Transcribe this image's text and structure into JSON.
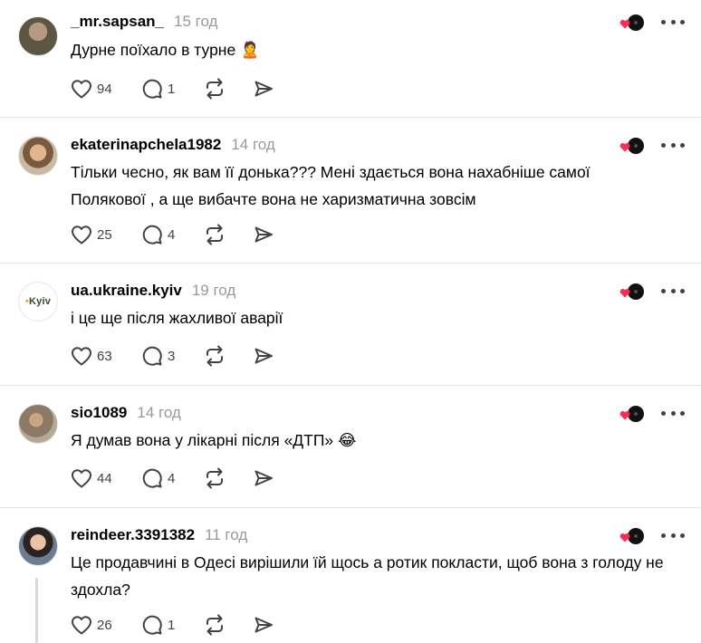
{
  "posts": [
    {
      "username": "_mr.sapsan_",
      "time": "15 год",
      "text": "Дурне поїхало в турне",
      "emoji": "🙎",
      "likes": "94",
      "replies": "1",
      "avatar": "person-avatar"
    },
    {
      "username": "ekaterinapchela1982",
      "time": "14 год",
      "text": "Тільки чесно, як вам її донька??? Мені здається вона нахабніше самої Полякової , а ще вибачте вона не харизматична зовсім",
      "likes": "25",
      "replies": "4",
      "avatar": "person-avatar"
    },
    {
      "username": "ua.ukraine.kyiv",
      "time": "19 год",
      "text": "і це ще після жахливої аварії",
      "likes": "63",
      "replies": "3",
      "avatar_logo_text": "Kyiv"
    },
    {
      "username": "sio1089",
      "time": "14 год",
      "text": "Я думав вона у лікарні після «ДТП»",
      "emoji": "😂",
      "likes": "44",
      "replies": "4",
      "avatar": "person-avatar"
    },
    {
      "username": "reindeer.3391382",
      "time": "11 год",
      "text": "Це продавчині в Одесі вирішили їй щось а ротик покласти, щоб вона з голоду не здохла?",
      "likes": "26",
      "replies": "1",
      "avatar": "person-avatar"
    }
  ],
  "icons": {
    "like": "heart-outline-icon",
    "reply": "speech-bubble-icon",
    "repost": "repost-arrows-icon",
    "share": "send-paper-plane-icon",
    "reaction": "heart-record-reaction-icon",
    "more": "more-dots-icon"
  },
  "colors": {
    "text": "#000000",
    "muted": "#999999",
    "icon": "#424242",
    "divider": "#e4e4e4",
    "reaction_heart": "#ff2d55"
  }
}
